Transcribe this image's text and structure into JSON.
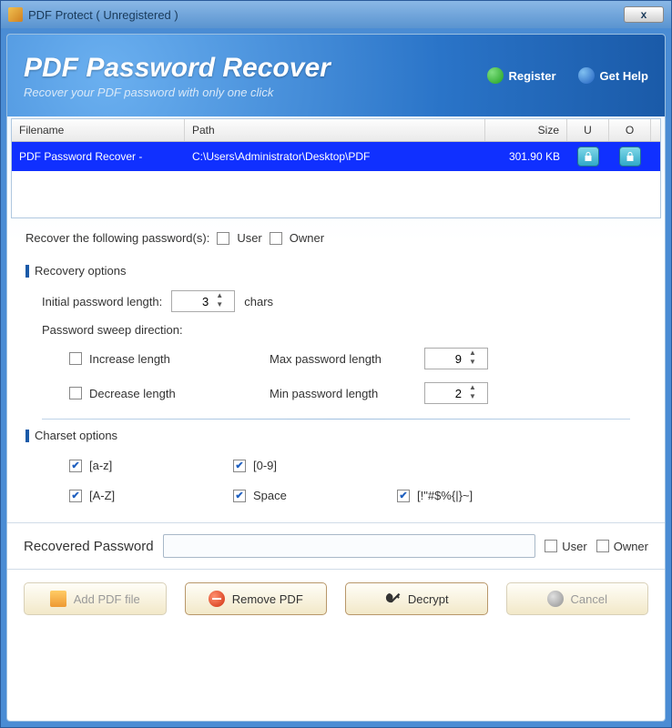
{
  "window": {
    "title": "PDF Protect ( Unregistered )"
  },
  "header": {
    "title": "PDF Password Recover",
    "subtitle": "Recover your PDF password with only one click",
    "register": "Register",
    "help": "Get Help"
  },
  "filelist": {
    "headers": {
      "filename": "Filename",
      "path": "Path",
      "size": "Size",
      "u": "U",
      "o": "O"
    },
    "rows": [
      {
        "filename": "PDF Password Recover - ",
        "path": "C:\\Users\\Administrator\\Desktop\\PDF",
        "size": "301.90 KB"
      }
    ]
  },
  "recover": {
    "label": "Recover the following password(s):",
    "user": "User",
    "owner": "Owner"
  },
  "recovery_options": {
    "title": "Recovery options",
    "initial_label": "Initial password length:",
    "initial_value": "3",
    "chars": "chars",
    "sweep_label": "Password sweep direction:",
    "increase": "Increase length",
    "decrease": "Decrease length",
    "max_label": "Max password length",
    "max_value": "9",
    "min_label": "Min password length",
    "min_value": "2"
  },
  "charset": {
    "title": "Charset options",
    "az": "[a-z]",
    "AZ": "[A-Z]",
    "digits": "[0-9]",
    "space": "Space",
    "symbols": "[!\"#$%{|}~]"
  },
  "recovered": {
    "label": "Recovered Password",
    "value": "",
    "user": "User",
    "owner": "Owner"
  },
  "buttons": {
    "add": "Add PDF file",
    "remove": "Remove PDF",
    "decrypt": "Decrypt",
    "cancel": "Cancel"
  }
}
